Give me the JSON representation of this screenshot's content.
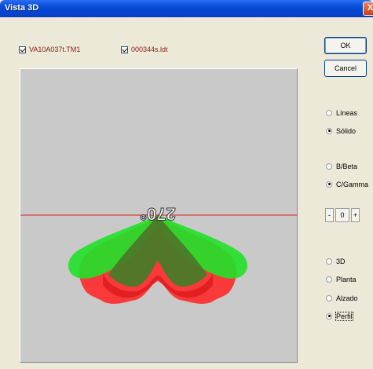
{
  "window": {
    "title": "Vista 3D",
    "close_label": "X"
  },
  "files": [
    {
      "label": "VA10A037t.TM1",
      "checked": true
    },
    {
      "label": "000344s.ldt",
      "checked": true
    }
  ],
  "buttons": {
    "ok": "OK",
    "cancel": "Cancel"
  },
  "render_mode": {
    "options": [
      "Líneas",
      "Sólido"
    ],
    "selected": "Sólido"
  },
  "color_mode": {
    "options": [
      "B/Beta",
      "C/Gamma"
    ],
    "selected": "C/Gamma"
  },
  "stepper": {
    "decrement": "-",
    "value": "0",
    "increment": "+"
  },
  "view_mode": {
    "options": [
      "3D",
      "Planta",
      "Alzado",
      "Perfil"
    ],
    "selected": "Perfil"
  },
  "viewport": {
    "angle_label": "270°",
    "background": "#c9c9c9",
    "horizon_color": "#e21b1b",
    "shape_colors": {
      "green": "#25e02b",
      "red": "#ff2a2a",
      "dark": "#4a7a28"
    }
  }
}
